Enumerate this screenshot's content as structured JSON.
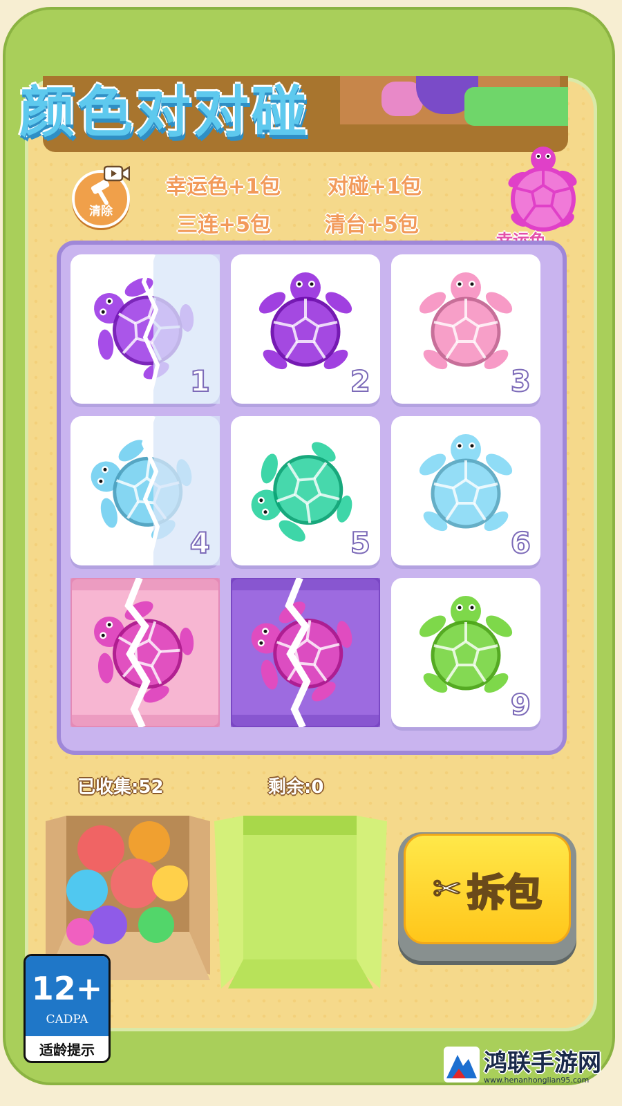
{
  "title": "颜色对对碰",
  "clear_button": {
    "label": "清除"
  },
  "rules": {
    "lucky_color": "幸运色+1包",
    "match_pair": "对碰+1包",
    "three_in_row": "三连+5包",
    "clear_board": "清台+5包"
  },
  "lucky": {
    "label": "幸运色",
    "color": "#e040c8"
  },
  "grid": [
    {
      "number": "1",
      "color": "#a64de8",
      "wrapped": "partial-open"
    },
    {
      "number": "2",
      "color": "#a040e0",
      "wrapped": "none"
    },
    {
      "number": "3",
      "color": "#f79ac6",
      "wrapped": "none"
    },
    {
      "number": "4",
      "color": "#7fd4f2",
      "wrapped": "partial-open"
    },
    {
      "number": "5",
      "color": "#3ed6a8",
      "wrapped": "none"
    },
    {
      "number": "6",
      "color": "#8fdcf6",
      "wrapped": "none"
    },
    {
      "number": "",
      "color": "#e04cc0",
      "wrapped": "pink-pack"
    },
    {
      "number": "",
      "color": "#e04cc0",
      "wrapped": "purple-pack"
    },
    {
      "number": "9",
      "color": "#7ed84a",
      "wrapped": "none"
    }
  ],
  "collected": {
    "label": "已收集:52"
  },
  "remaining": {
    "label": "剩余:0"
  },
  "unpack_button": {
    "label": "拆包",
    "icon": "scissors-icon"
  },
  "age_rating": {
    "age": "12+",
    "org": "CADPA",
    "caption": "适龄提示"
  },
  "watermark": {
    "brand": "鸿联手游网",
    "site": "www.henanhonglian95.com"
  }
}
